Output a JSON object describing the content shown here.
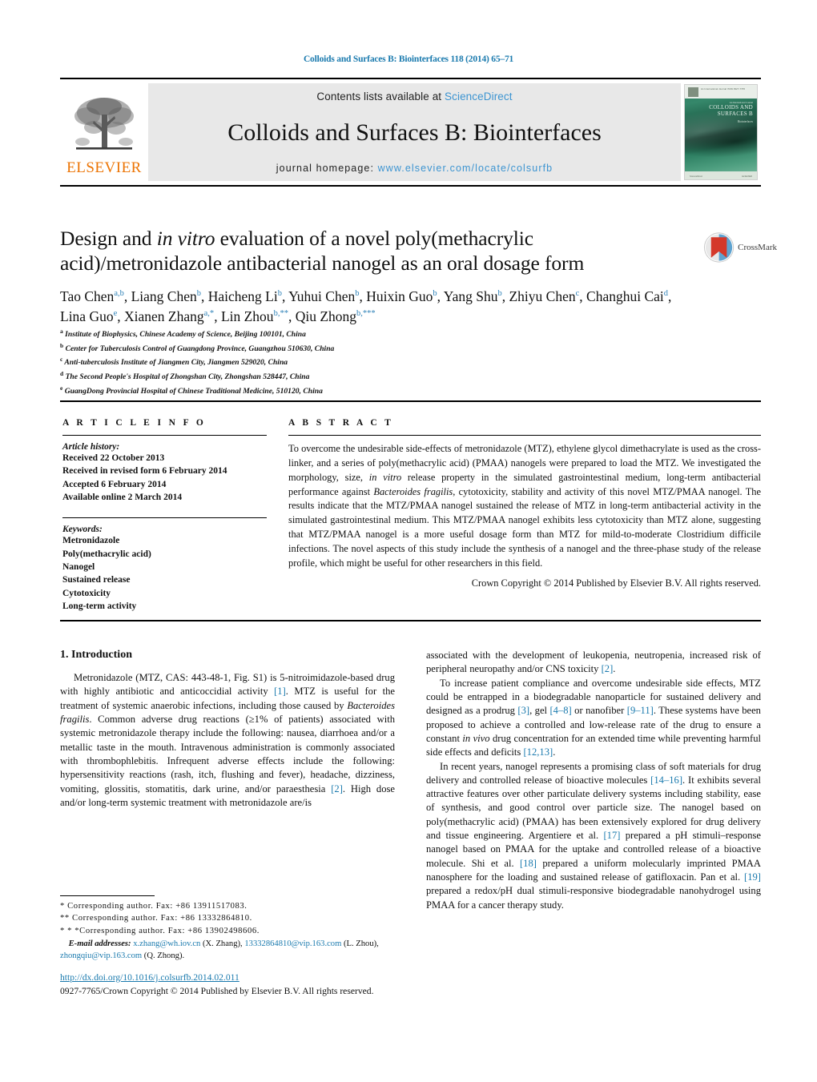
{
  "running_head": "Colloids and Surfaces B: Biointerfaces 118 (2014) 65–71",
  "masthead": {
    "publisher_logo_label": "ELSEVIER",
    "contents_prefix": "Contents lists available at ",
    "contents_link": "ScienceDirect",
    "journal_title": "Colloids and Surfaces B: Biointerfaces",
    "homepage_prefix": "journal homepage: ",
    "homepage_url": "www.elsevier.com/locate/colsurfb",
    "cover": {
      "header_small": "An International Journal        ISSN 0927-7765",
      "line1": "An International Journal",
      "line2": "COLLOIDS AND SURFACES B",
      "line3": "Biointerfaces",
      "footer_left": "ScienceDirect",
      "footer_right": "ELSEVIER"
    }
  },
  "article": {
    "title_part1": "Design and ",
    "title_italic": "in vitro",
    "title_part2": " evaluation of a novel poly(methacrylic acid)/metronidazole antibacterial nanogel as an oral dosage form",
    "crossmark_label": "CrossMark",
    "authors": [
      {
        "name": "Tao Chen",
        "sup": "a,b",
        "sep": ", "
      },
      {
        "name": "Liang Chen",
        "sup": "b",
        "sep": ", "
      },
      {
        "name": "Haicheng Li",
        "sup": "b",
        "sep": ", "
      },
      {
        "name": "Yuhui Chen",
        "sup": "b",
        "sep": ", "
      },
      {
        "name": "Huixin Guo",
        "sup": "b",
        "sep": ", "
      },
      {
        "name": "Yang Shu",
        "sup": "b",
        "sep": ", "
      },
      {
        "name": "Zhiyu Chen",
        "sup": "c",
        "sep": ", "
      },
      {
        "name": "Changhui Cai",
        "sup": "d",
        "sep": ", "
      },
      {
        "name": "Lina Guo",
        "sup": "e",
        "sep": ", "
      },
      {
        "name": "Xianen Zhang",
        "sup": "a,*",
        "sep": ", "
      },
      {
        "name": "Lin Zhou",
        "sup": "b,**",
        "sep": ", "
      },
      {
        "name": "Qiu Zhong",
        "sup": "b,***",
        "sep": ""
      }
    ],
    "affiliations": [
      {
        "marker": "a",
        "text": "Institute of Biophysics, Chinese Academy of Science, Beijing 100101, China"
      },
      {
        "marker": "b",
        "text": "Center for Tuberculosis Control of Guangdong Province, Guangzhou 510630, China"
      },
      {
        "marker": "c",
        "text": "Anti-tuberculosis Institute of Jiangmen City, Jiangmen 529020, China"
      },
      {
        "marker": "d",
        "text": "The Second People's Hospital of Zhongshan City, Zhongshan 528447, China"
      },
      {
        "marker": "e",
        "text": "GuangDong Provincial Hospital of Chinese Traditional Medicine, 510120, China"
      }
    ]
  },
  "article_info": {
    "heading": "A R T I C L E   I N F O",
    "history_label": "Article history:",
    "history": [
      "Received 22 October 2013",
      "Received in revised form 6 February 2014",
      "Accepted 6 February 2014",
      "Available online 2 March 2014"
    ],
    "keywords_label": "Keywords:",
    "keywords": [
      "Metronidazole",
      "Poly(methacrylic acid)",
      "Nanogel",
      "Sustained release",
      "Cytotoxicity",
      "Long-term activity"
    ]
  },
  "abstract": {
    "heading": "A B S T R A C T",
    "p1": "To overcome the undesirable side-effects of metronidazole (MTZ), ethylene glycol dimethacrylate is used as the cross-linker, and a series of poly(methacrylic acid) (PMAA) nanogels were prepared to load the MTZ. We investigated the morphology, size, ",
    "italic1": "in vitro",
    "p2": " release property in the simulated gastrointestinal medium, long-term antibacterial performance against ",
    "italic2": "Bacteroides fragilis",
    "p3": ", cytotoxicity, stability and activity of this novel MTZ/PMAA nanogel. The results indicate that the MTZ/PMAA nanogel sustained the release of MTZ in long-term antibacterial activity in the simulated gastrointestinal medium. This MTZ/PMAA nanogel exhibits less cytotoxicity than MTZ alone, suggesting that MTZ/PMAA nanogel is a more useful dosage form than MTZ for mild-to-moderate Clostridium difficile infections. The novel aspects of this study include the synthesis of a nanogel and the three-phase study of the release profile, which might be useful for other researchers in this field.",
    "copyright": "Crown Copyright © 2014 Published by Elsevier B.V. All rights reserved."
  },
  "body": {
    "section1_title": "1.  Introduction",
    "left_p1_a": "Metronidazole (MTZ, CAS: 443-48-1, Fig. S1) is 5-nitroimidazole-based drug with highly antibiotic and anticoccidial activity ",
    "left_p1_ref1": "[1]",
    "left_p1_b": ". MTZ is useful for the treatment of systemic anaerobic infections, including those caused by ",
    "left_p1_italic": "Bacteroides fragilis",
    "left_p1_c": ". Common adverse drug reactions (≥1% of patients) associated with systemic metronidazole therapy include the following: nausea, diarrhoea and/or a metallic taste in the mouth. Intravenous administration is commonly associated with thrombophlebitis. Infrequent adverse effects include the following: hypersensitivity reactions (rash, itch, flushing and fever), headache, dizziness, vomiting, glossitis, stomatitis, dark urine, and/or paraesthesia ",
    "left_p1_ref2": "[2]",
    "left_p1_d": ". High dose and/or long-term systemic treatment with metronidazole are/is",
    "right_p1_a": "associated with the development of leukopenia, neutropenia, increased risk of peripheral neuropathy and/or CNS toxicity ",
    "right_p1_ref": "[2]",
    "right_p1_b": ".",
    "right_p2_a": "To increase patient compliance and overcome undesirable side effects, MTZ could be entrapped in a biodegradable nanoparticle for sustained delivery and designed as a prodrug ",
    "right_p2_ref1": "[3]",
    "right_p2_b": ", gel ",
    "right_p2_ref2": "[4–8]",
    "right_p2_c": " or nanofiber ",
    "right_p2_ref3": "[9–11]",
    "right_p2_d": ". These systems have been proposed to achieve a controlled and low-release rate of the drug to ensure a constant ",
    "right_p2_italic": "in vivo",
    "right_p2_e": " drug concentration for an extended time while preventing harmful side effects and deficits ",
    "right_p2_ref4": "[12,13]",
    "right_p2_f": ".",
    "right_p3_a": "In recent years, nanogel represents a promising class of soft materials for drug delivery and controlled release of bioactive molecules ",
    "right_p3_ref1": "[14–16]",
    "right_p3_b": ". It exhibits several attractive features over other particulate delivery systems including stability, ease of synthesis, and good control over particle size. The nanogel based on poly(methacrylic acid) (PMAA) has been extensively explored for drug delivery and tissue engineering. Argentiere et al. ",
    "right_p3_ref2": "[17]",
    "right_p3_c": " prepared a pH stimuli–response nanogel based on PMAA for the uptake and controlled release of a bioactive molecule. Shi et al. ",
    "right_p3_ref3": "[18]",
    "right_p3_d": " prepared a uniform molecularly imprinted PMAA nanosphere for the loading and sustained release of gatifloxacin. Pan et al. ",
    "right_p3_ref4": "[19]",
    "right_p3_e": " prepared a redox/pH dual stimuli-responsive biodegradable nanohydrogel using PMAA for a cancer therapy study."
  },
  "footnotes": {
    "line1": "*  Corresponding author. Fax: +86 13911517083.",
    "line2": "**  Corresponding author. Fax: +86 13332864810.",
    "line3": "* * *Corresponding author. Fax: +86 13902498606.",
    "email_label": "E-mail addresses:",
    "email1": "x.zhang@wh.iov.cn",
    "email1_owner": " (X. Zhang), ",
    "email2": "13332864810@vip.163.com",
    "email2_owner": " (L. Zhou), ",
    "email3": "zhongqiu@vip.163.com",
    "email3_owner": " (Q. Zhong)."
  },
  "footer": {
    "doi": "http://dx.doi.org/10.1016/j.colsurfb.2014.02.011",
    "issn_line": "0927-7765/Crown Copyright © 2014 Published by Elsevier B.V. All rights reserved."
  },
  "colors": {
    "link_blue": "#1a7aae",
    "sd_blue": "#3c94d1",
    "elsevier_orange": "#ec7404",
    "masthead_gray": "#e8e8e8",
    "crossmark_red": "#d4382a",
    "crossmark_blue": "#4a90c4"
  }
}
